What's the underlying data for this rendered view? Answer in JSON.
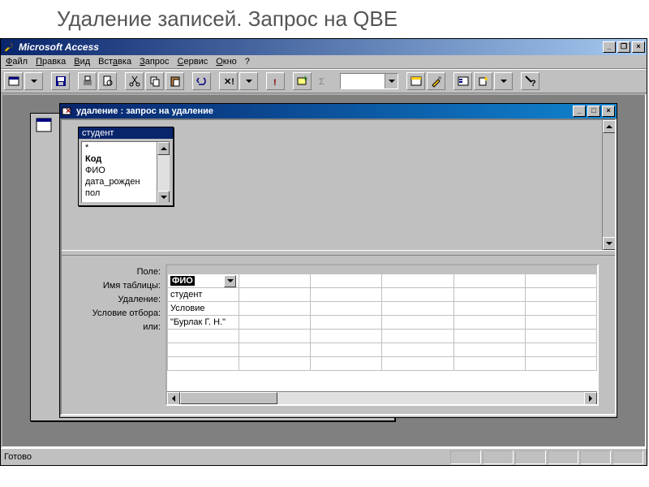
{
  "slide_title": "Удаление записей. Запрос на QBE",
  "app": {
    "title": "Microsoft Access",
    "window_controls": {
      "min": "_",
      "max": "❐",
      "close": "×"
    }
  },
  "menu": {
    "file": "Файл",
    "edit": "Правка",
    "view": "Вид",
    "insert": "Вставка",
    "query": "Запрос",
    "service": "Сервис",
    "window": "Окно",
    "help": "?"
  },
  "toolbar": {
    "combo_value": ""
  },
  "design_window": {
    "title": "удаление : запрос на удаление",
    "table_box": {
      "header": "студент",
      "fields": [
        "*",
        "Код",
        "ФИО",
        "дата_рожден",
        "пол"
      ]
    }
  },
  "qbe_grid": {
    "row_labels": {
      "field": "Поле:",
      "table": "Имя таблицы:",
      "delete": "Удаление:",
      "criteria": "Условие отбора:",
      "or": "или:"
    },
    "col1": {
      "field": "ФИО",
      "table": "студент",
      "delete": "Условие",
      "criteria": "\"Бурлак Г. Н.\"",
      "or": ""
    }
  },
  "statusbar": {
    "text": "Готово"
  }
}
